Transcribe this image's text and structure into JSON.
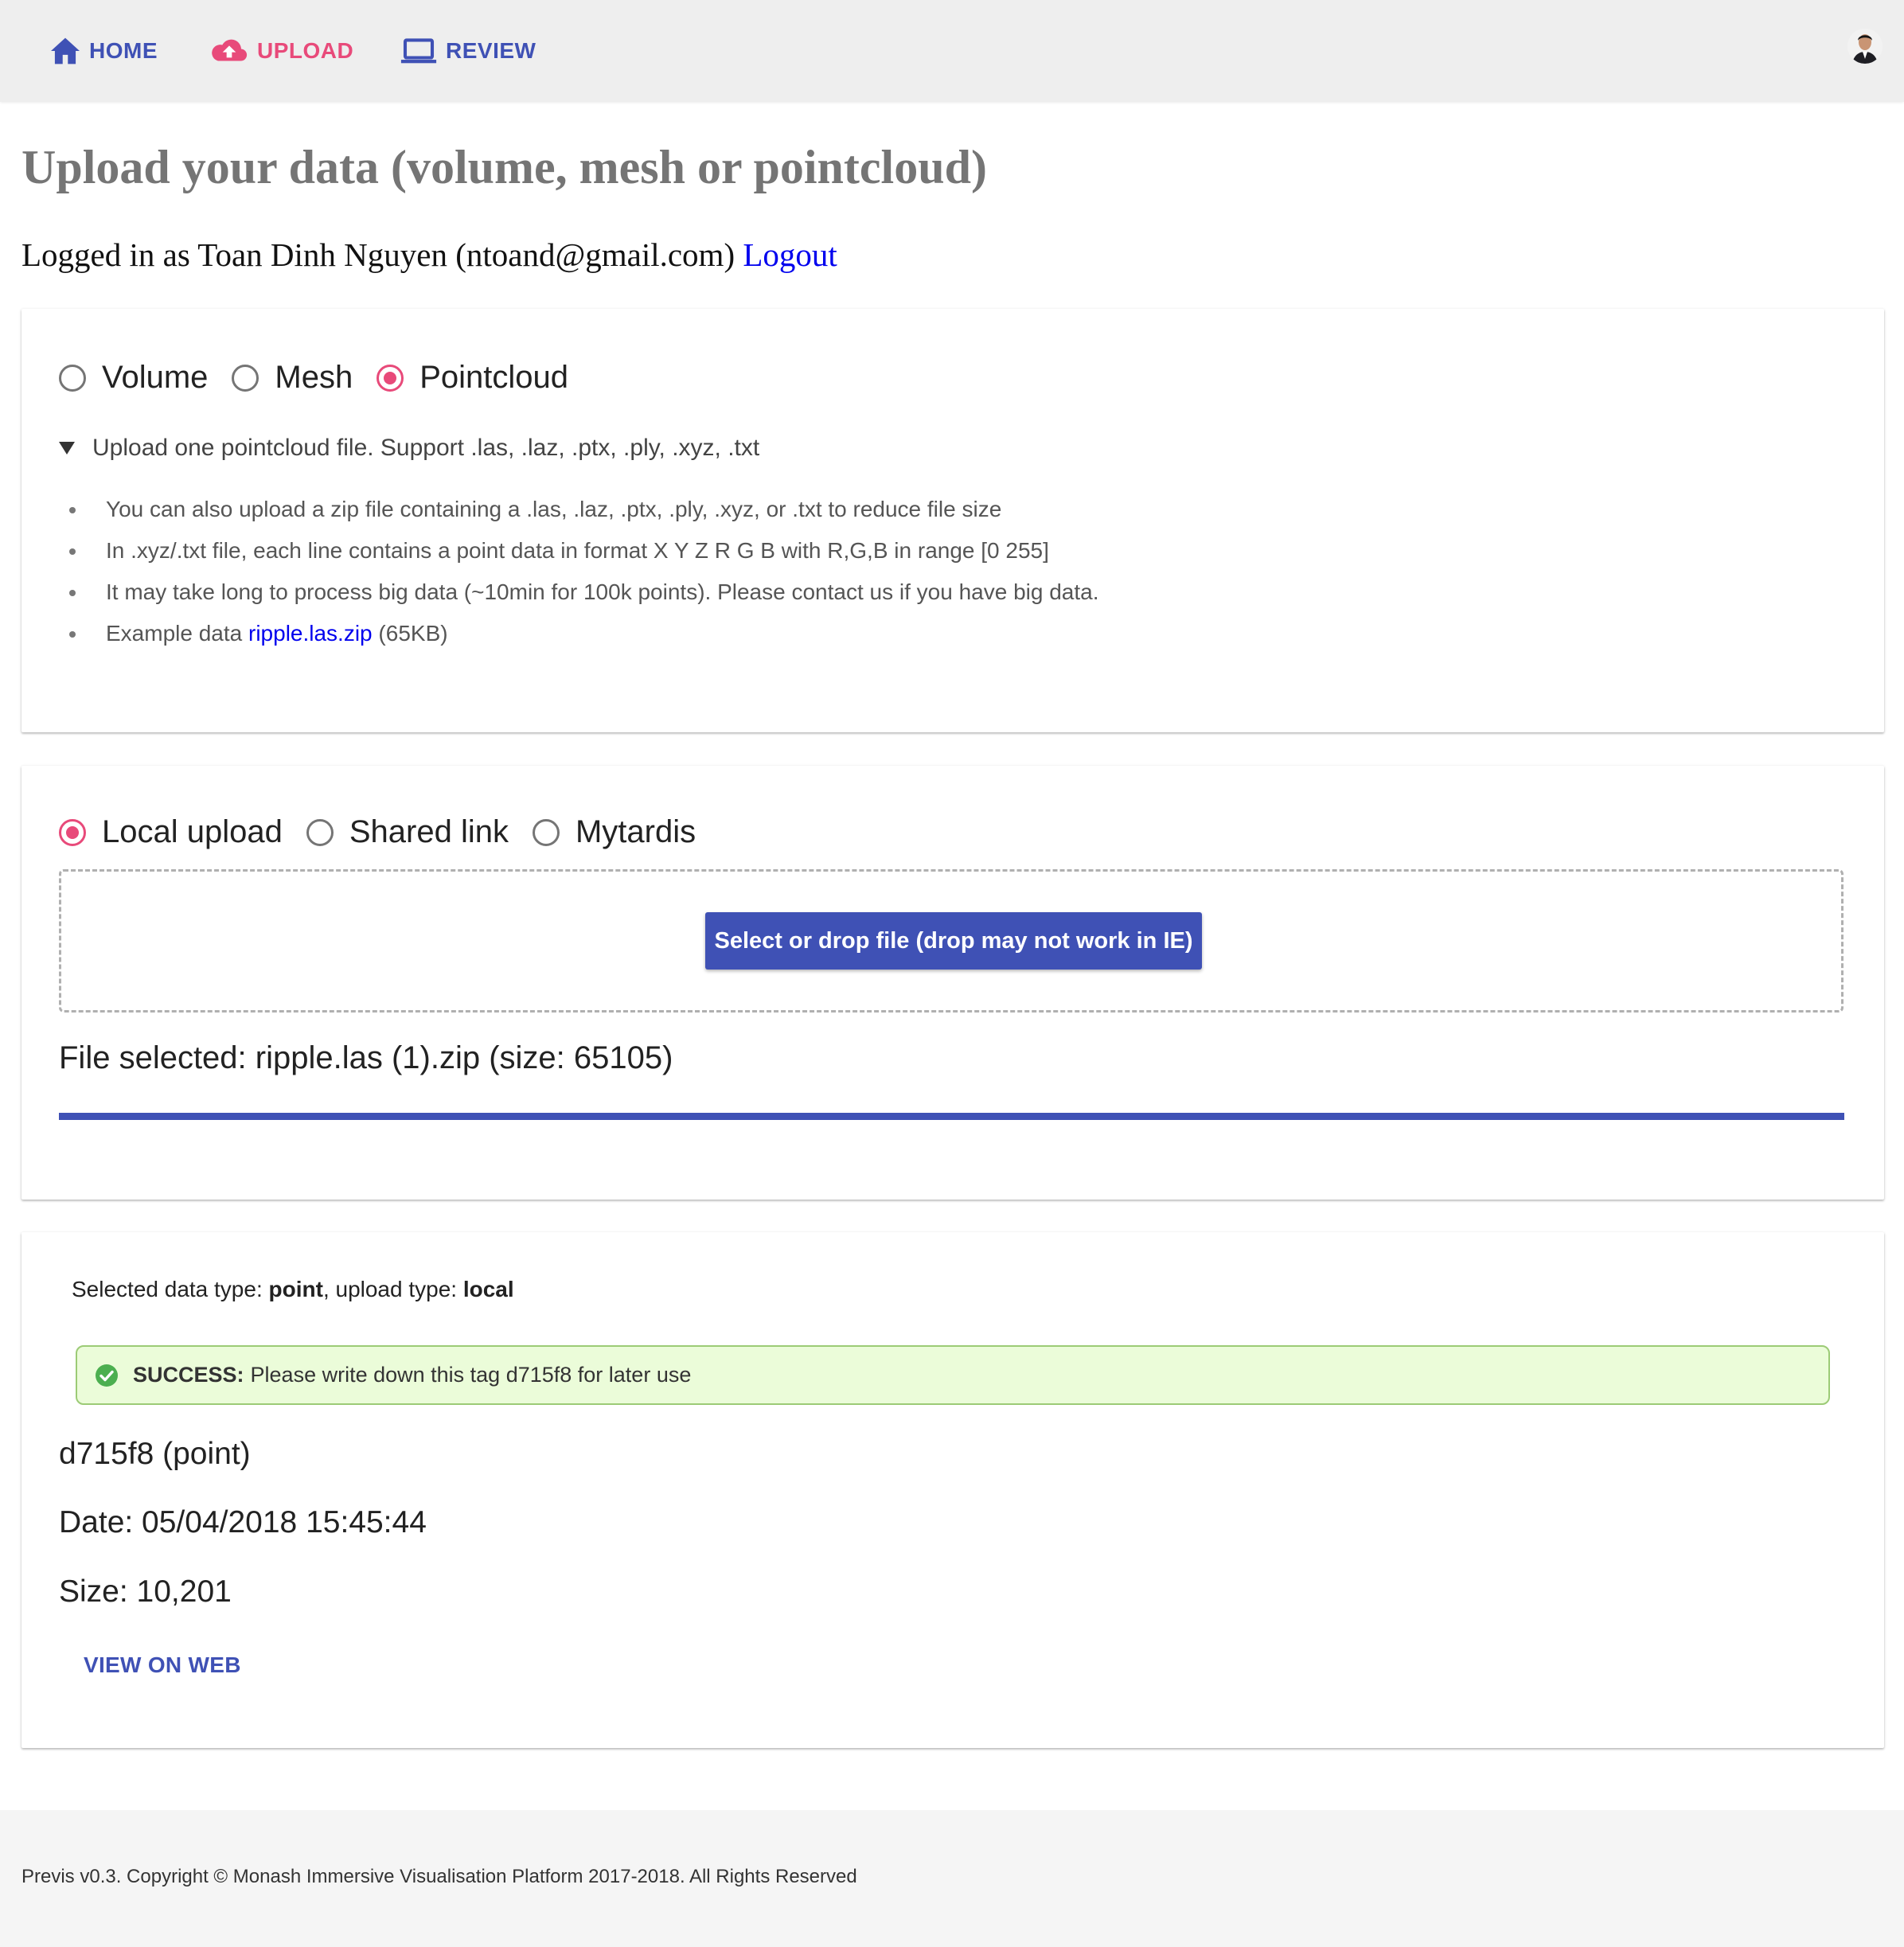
{
  "nav": {
    "home_label": "HOME",
    "upload_label": "UPLOAD",
    "review_label": "REVIEW",
    "icons": {
      "home": "home-icon",
      "upload": "cloud-upload-icon",
      "review": "laptop-icon"
    },
    "colors": {
      "primary": "#3f51b5",
      "active": "#e84a7a"
    }
  },
  "header": {
    "title": "Upload your data (volume, mesh or pointcloud)",
    "login_prefix": "Logged in as Toan Dinh Nguyen (ntoand@gmail.com)",
    "logout_label": "Logout"
  },
  "data_type": {
    "options": [
      "Volume",
      "Mesh",
      "Pointcloud"
    ],
    "selected": "Pointcloud",
    "summary": "Upload one pointcloud file. Support .las, .laz, .ptx, .ply, .xyz, .txt",
    "bullets": [
      "You can also upload a zip file containing a .las, .laz, .ptx, .ply, .xyz, or .txt to reduce file size",
      "In .xyz/.txt file, each line contains a point data in format X Y Z R G B with R,G,B in range [0 255]",
      "It may take long to process big data (~10min for 100k points). Please contact us if you have big data."
    ],
    "example_prefix": "Example data",
    "example_link": "ripple.las.zip",
    "example_size": "(65KB)"
  },
  "upload": {
    "options": [
      "Local upload",
      "Shared link",
      "Mytardis"
    ],
    "selected": "Local upload",
    "button_label": "Select or drop file (drop may not work in IE)",
    "file_selected": "File selected: ripple.las (1).zip (size: 65105)",
    "progress": 1.0
  },
  "result": {
    "status_prefix": "Selected data type:",
    "data_type": "point",
    "upload_type_prefix": ", upload type:",
    "upload_type": "local",
    "success_label": "SUCCESS:",
    "success_message": "Please write down this tag d715f8 for later use",
    "tag_line": "d715f8 (point)",
    "date_line": "Date: 05/04/2018 15:45:44",
    "size_line": "Size: 10,201",
    "view_label": "VIEW ON WEB",
    "success_colors": {
      "background": "#ebfcd9",
      "border": "#9ccb76",
      "check": "#4caf50"
    }
  },
  "footer": {
    "text": "Previs v0.3. Copyright © Monash Immersive Visualisation Platform 2017-2018. All Rights Reserved"
  }
}
